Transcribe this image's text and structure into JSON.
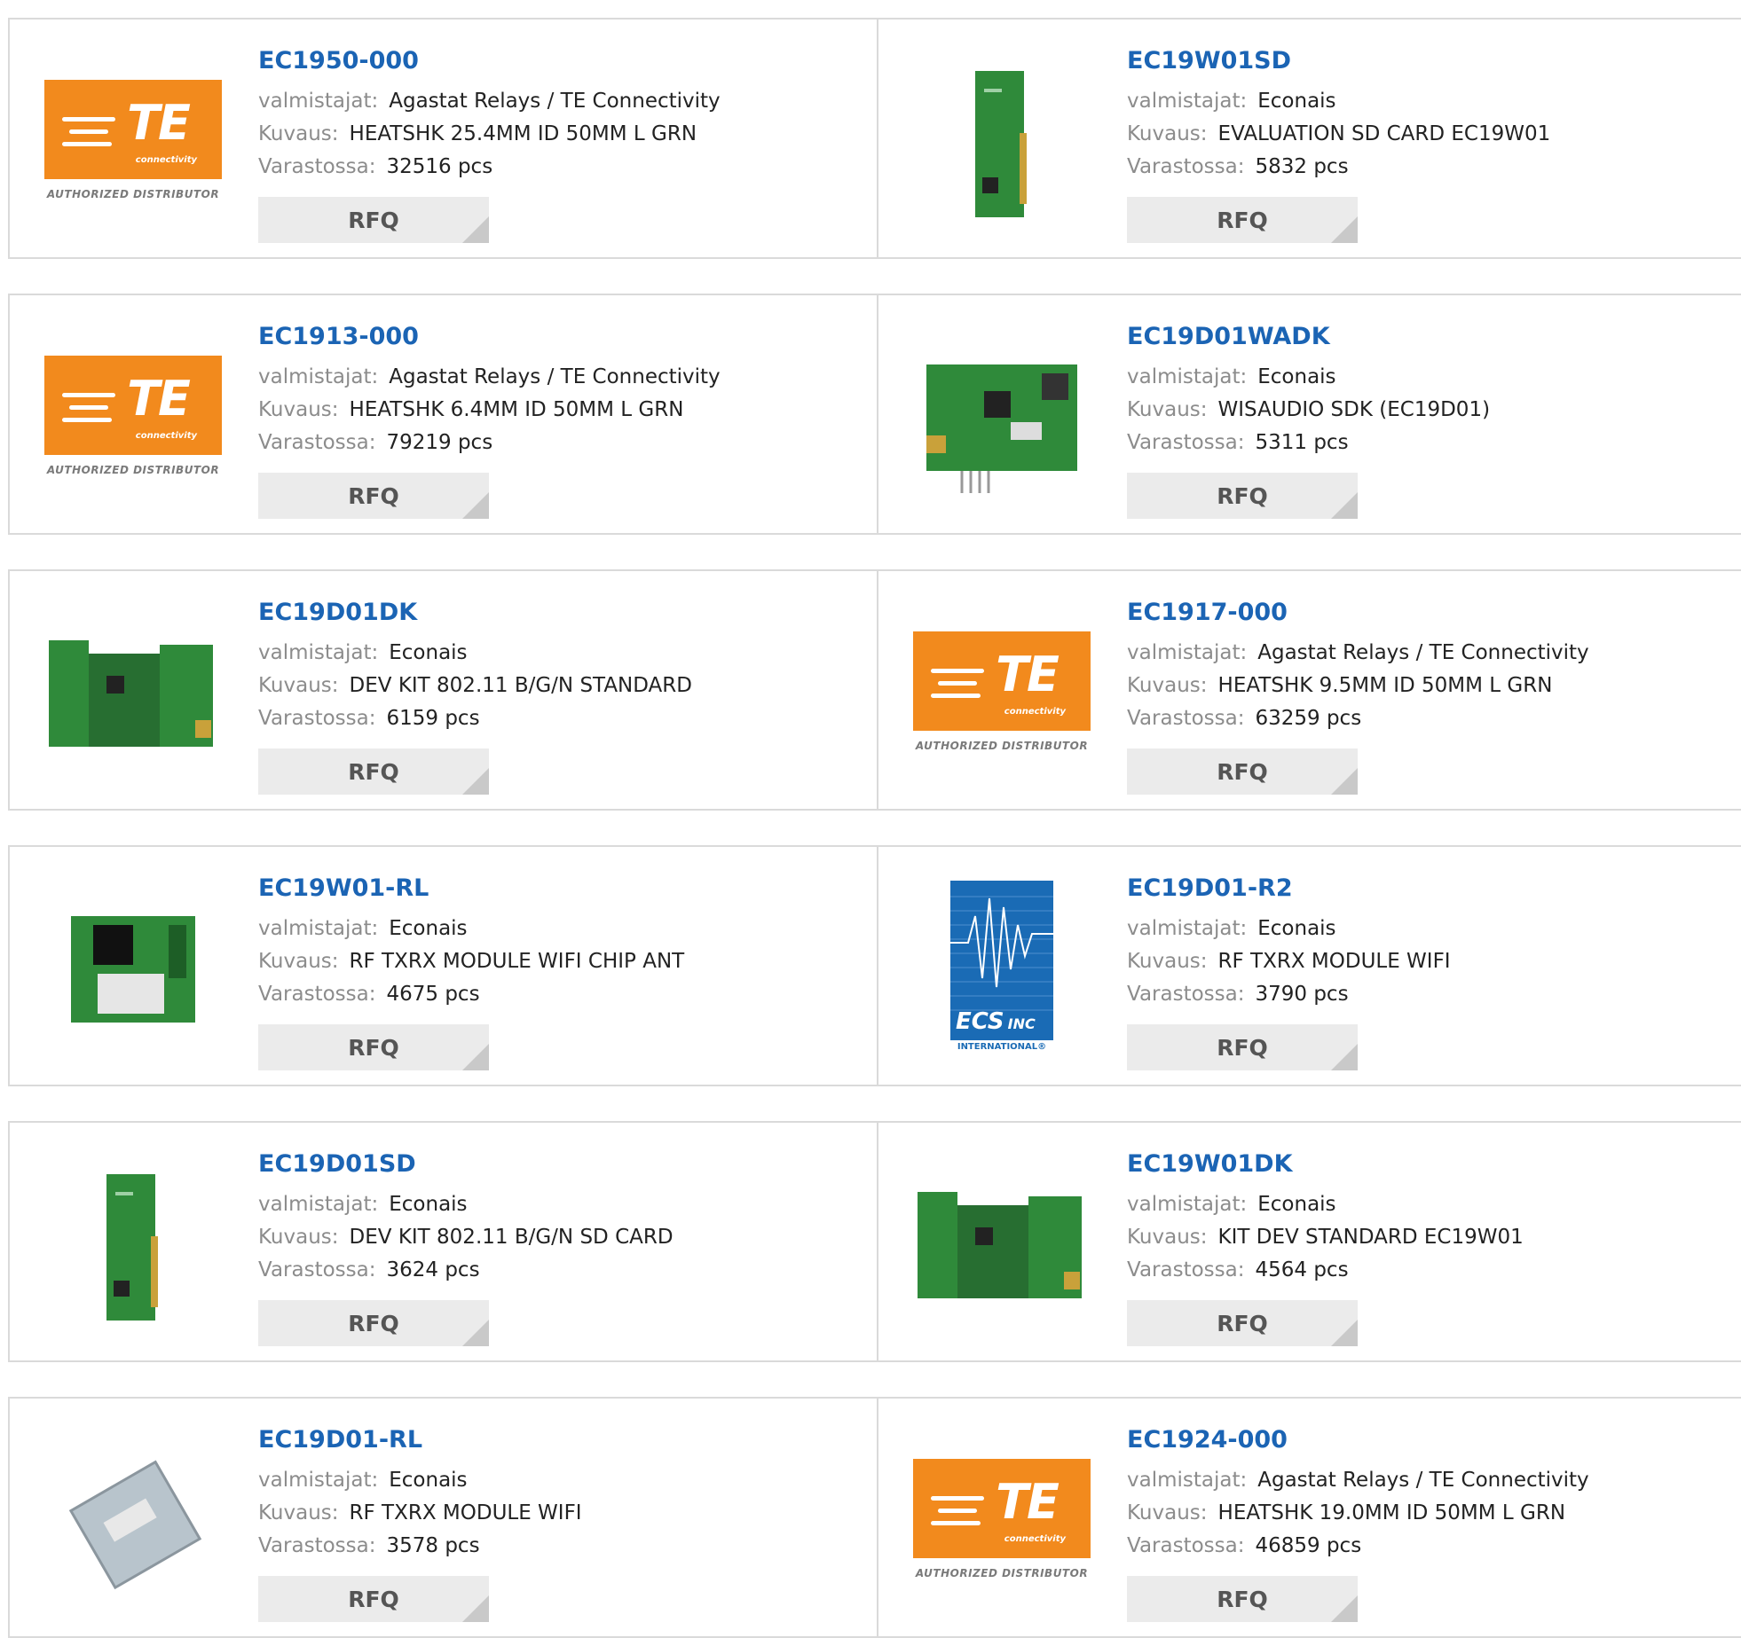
{
  "labels": {
    "manufacturer": "valmistajat:",
    "description": "Kuvaus:",
    "stock": "Varastossa:",
    "rfq": "RFQ"
  },
  "colors": {
    "link": "#1b64b4",
    "border": "#dadada",
    "te_orange": "#f28a1d",
    "ecs_blue": "#1a6bb5",
    "pcb_green": "#2f8a3a"
  },
  "logos": {
    "te": {
      "letters": "TE",
      "tagline": "connectivity",
      "authorized": "AUTHORIZED DISTRIBUTOR"
    },
    "ecs": {
      "name": "ECS",
      "inc": "INC",
      "international": "INTERNATIONAL®"
    }
  },
  "products": [
    {
      "part": "EC1950-000",
      "manufacturer": "Agastat Relays / TE Connectivity",
      "description": "HEATSHK 25.4MM ID 50MM L GRN",
      "stock": "32516 pcs",
      "image": "te-logo"
    },
    {
      "part": "EC19W01SD",
      "manufacturer": "Econais",
      "description": "EVALUATION SD CARD EC19W01",
      "stock": "5832 pcs",
      "image": "sd-card-board"
    },
    {
      "part": "EC1913-000",
      "manufacturer": "Agastat Relays / TE Connectivity",
      "description": "HEATSHK 6.4MM ID 50MM L GRN",
      "stock": "79219 pcs",
      "image": "te-logo"
    },
    {
      "part": "EC19D01WADK",
      "manufacturer": "Econais",
      "description": "WISAUDIO SDK (EC19D01)",
      "stock": "5311 pcs",
      "image": "audio-board"
    },
    {
      "part": "EC19D01DK",
      "manufacturer": "Econais",
      "description": "DEV KIT 802.11 B/G/N STANDARD",
      "stock": "6159 pcs",
      "image": "dev-kit-board"
    },
    {
      "part": "EC1917-000",
      "manufacturer": "Agastat Relays / TE Connectivity",
      "description": "HEATSHK 9.5MM ID 50MM L GRN",
      "stock": "63259 pcs",
      "image": "te-logo"
    },
    {
      "part": "EC19W01-RL",
      "manufacturer": "Econais",
      "description": "RF TXRX MODULE WIFI CHIP ANT",
      "stock": "4675 pcs",
      "image": "wifi-module"
    },
    {
      "part": "EC19D01-R2",
      "manufacturer": "Econais",
      "description": "RF TXRX MODULE WIFI",
      "stock": "3790 pcs",
      "image": "ecs-logo"
    },
    {
      "part": "EC19D01SD",
      "manufacturer": "Econais",
      "description": "DEV KIT 802.11 B/G/N SD CARD",
      "stock": "3624 pcs",
      "image": "sd-card-board"
    },
    {
      "part": "EC19W01DK",
      "manufacturer": "Econais",
      "description": "KIT DEV STANDARD EC19W01",
      "stock": "4564 pcs",
      "image": "dev-kit-board"
    },
    {
      "part": "EC19D01-RL",
      "manufacturer": "Econais",
      "description": "RF TXRX MODULE WIFI",
      "stock": "3578 pcs",
      "image": "shield-module"
    },
    {
      "part": "EC1924-000",
      "manufacturer": "Agastat Relays / TE Connectivity",
      "description": "HEATSHK 19.0MM ID 50MM L GRN",
      "stock": "46859 pcs",
      "image": "te-logo"
    }
  ]
}
